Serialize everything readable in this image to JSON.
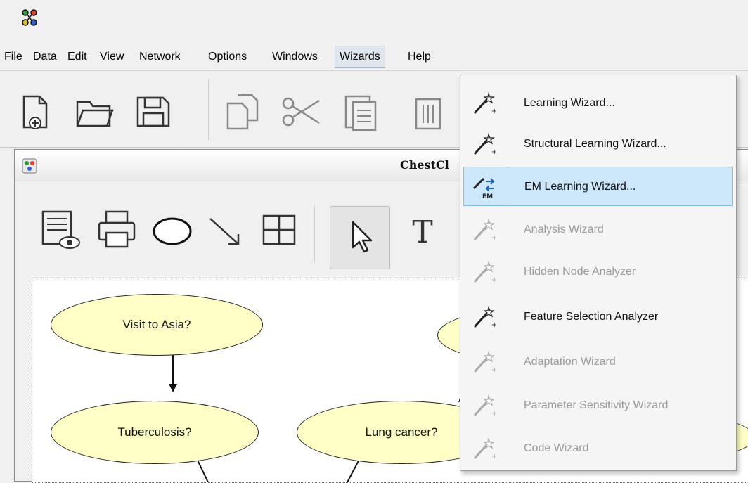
{
  "menubar": {
    "items": [
      "File",
      "Data",
      "Edit",
      "View",
      "Network",
      "Options",
      "Windows",
      "Wizards",
      "Help"
    ],
    "active": "Wizards"
  },
  "document": {
    "title": "ChestCl"
  },
  "nodes": {
    "visit_to_asia": "Visit to Asia?",
    "tuberculosis": "Tuberculosis?",
    "lung_cancer": "Lung cancer?"
  },
  "wizards_menu": {
    "items": [
      {
        "label": "Learning Wizard...",
        "enabled": true,
        "icon": "wand-icon"
      },
      {
        "label": "Structural Learning Wizard...",
        "enabled": true,
        "icon": "wand-icon"
      },
      {
        "label": "EM Learning Wizard...",
        "enabled": true,
        "selected": true,
        "icon": "em-wand-icon"
      },
      {
        "label": "Analysis Wizard",
        "enabled": false,
        "icon": "wand-icon"
      },
      {
        "label": "Hidden Node Analyzer",
        "enabled": false,
        "icon": "wand-icon"
      },
      {
        "label": "Feature Selection Analyzer",
        "enabled": true,
        "icon": "wand-icon"
      },
      {
        "label": "Adaptation Wizard",
        "enabled": false,
        "icon": "wand-icon"
      },
      {
        "label": "Parameter Sensitivity Wizard",
        "enabled": false,
        "icon": "wand-icon"
      },
      {
        "label": "Code Wizard",
        "enabled": false,
        "icon": "wand-icon"
      }
    ]
  },
  "colors": {
    "node_fill": "#ffffc6",
    "selected_item": "#cde8fb",
    "disabled_text": "#9a9a9a"
  }
}
